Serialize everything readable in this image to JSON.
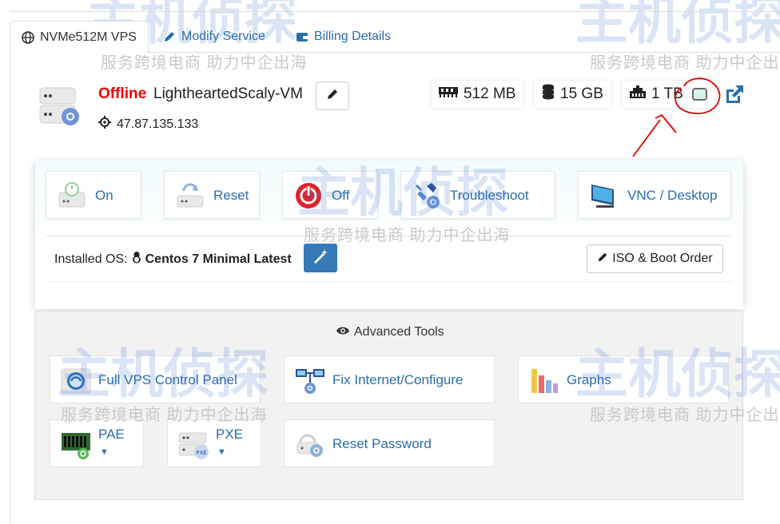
{
  "tabs": [
    {
      "label": "NVMe512M VPS",
      "icon": "globe-icon",
      "active": true
    },
    {
      "label": "Modify Service",
      "icon": "pencil-icon",
      "active": false
    },
    {
      "label": "Billing Details",
      "icon": "billing-icon",
      "active": false
    }
  ],
  "vm": {
    "status": "Offline",
    "name": "LightheartedScaly-VM",
    "ip": "47.87.135.133",
    "status_color": "#e00000"
  },
  "stats": {
    "ram": "512 MB",
    "disk": "15 GB",
    "bandwidth": "1 TB"
  },
  "power": {
    "on": "On",
    "reset": "Reset",
    "off": "Off",
    "troubleshoot": "Troubleshoot",
    "vnc": "VNC / Desktop"
  },
  "os": {
    "label": "Installed OS:",
    "value": "Centos 7 Minimal Latest",
    "iso_button": "ISO & Boot Order"
  },
  "advanced": {
    "title": "Advanced Tools",
    "items": [
      {
        "label": "Full VPS Control Panel",
        "icon": "control-panel-icon"
      },
      {
        "label": "Fix Internet/Configure",
        "icon": "network-icon"
      },
      {
        "label": "Graphs",
        "icon": "graphs-icon"
      },
      {
        "label": "PAE",
        "icon": "memory-chip-icon"
      },
      {
        "label": "PXE",
        "icon": "pxe-server-icon"
      },
      {
        "label": "Reset Password",
        "icon": "reset-password-icon"
      }
    ]
  },
  "watermark": {
    "logo": "主机侦探",
    "tagline": "服务跨境电商 助力中企出海"
  },
  "colors": {
    "link": "#2a6db0",
    "primary_button": "#337ab7",
    "offline": "#e00000",
    "annotation": "#e00000"
  }
}
